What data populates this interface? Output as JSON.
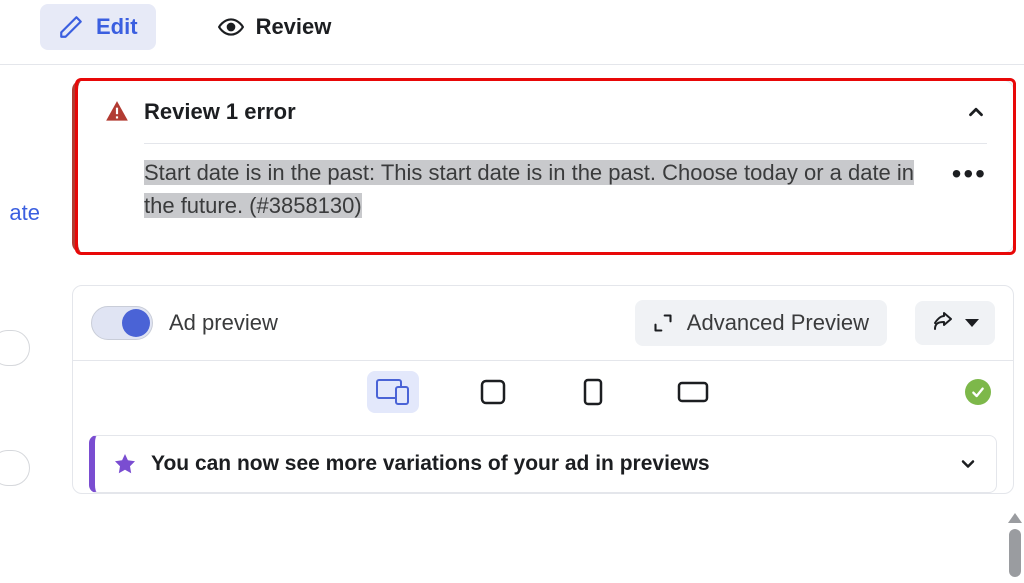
{
  "tabs": {
    "edit": "Edit",
    "review": "Review"
  },
  "left_fragment": "ate",
  "error": {
    "title": "Review 1 error",
    "message": "Start date is in the past: This start date is in the past. Choose today or a date in the future. (#3858130)"
  },
  "preview": {
    "toggle_label": "Ad preview",
    "advanced_button": "Advanced Preview"
  },
  "info": {
    "title": "You can now see more variations of your ad in previews"
  }
}
